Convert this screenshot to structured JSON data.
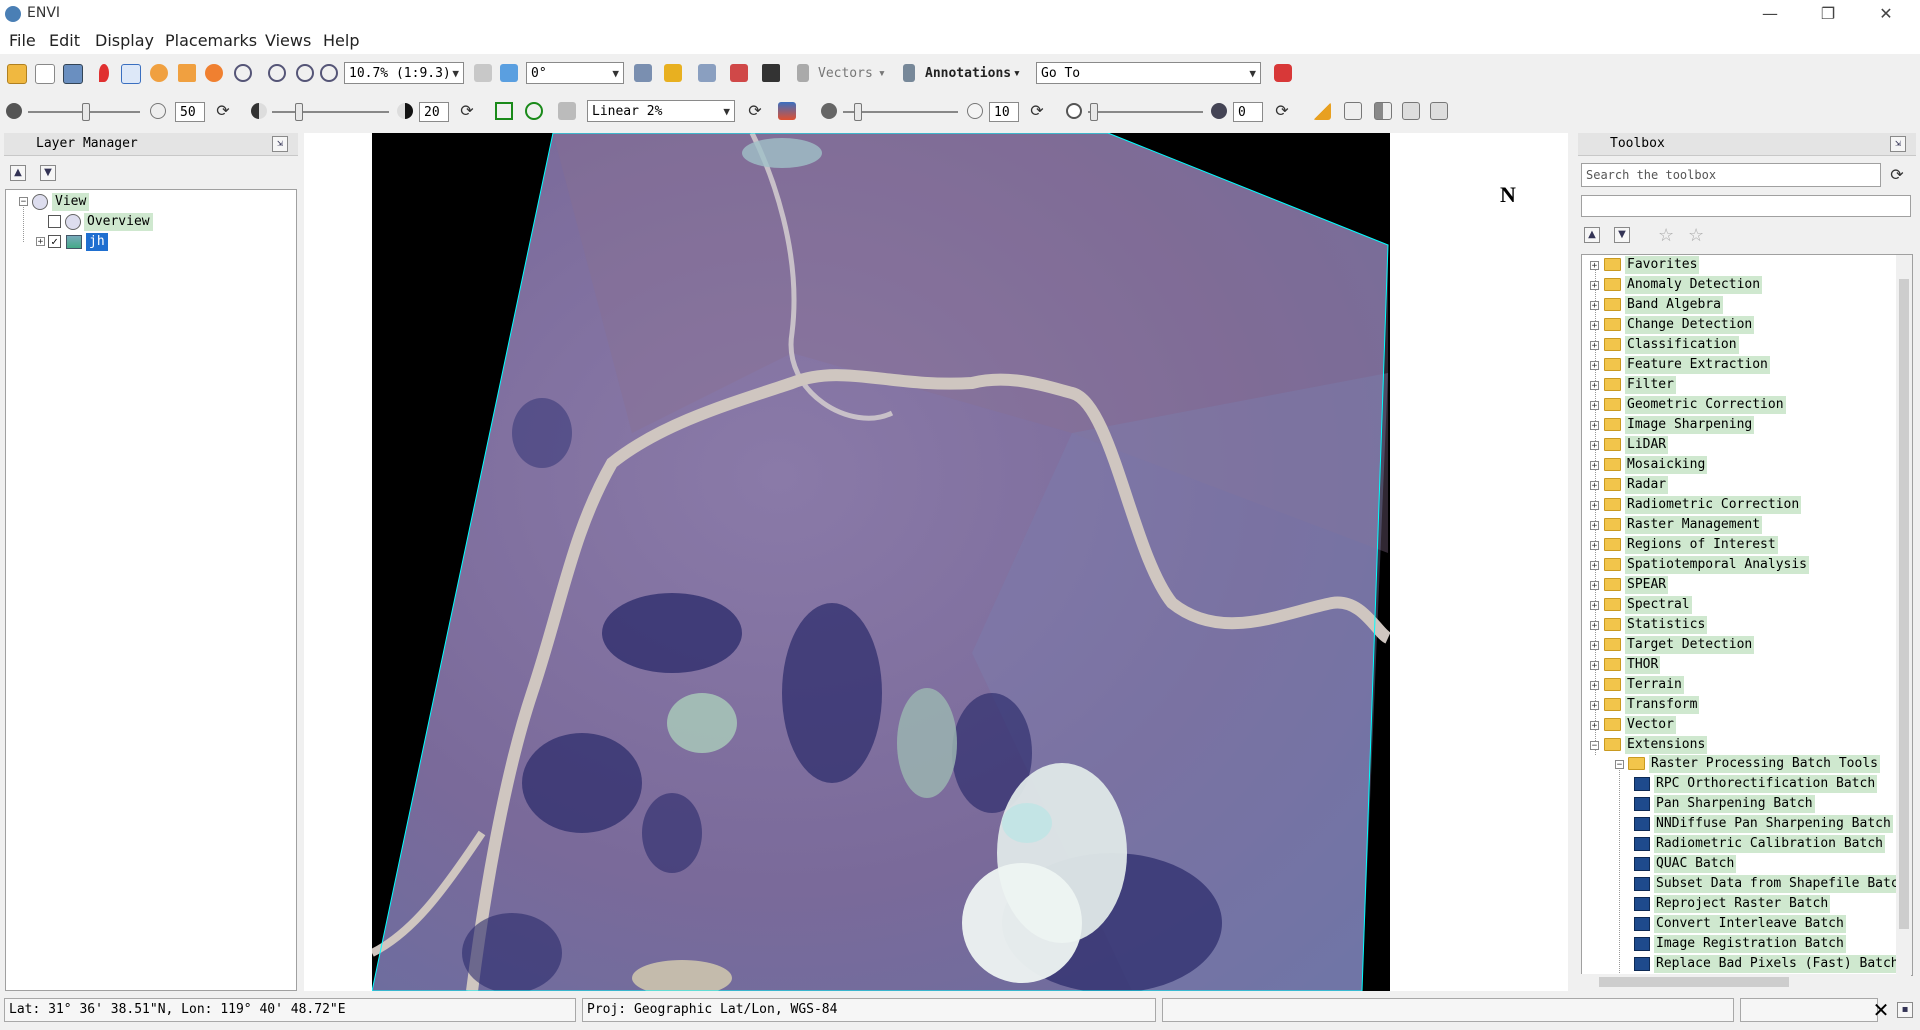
{
  "window": {
    "title": "ENVI",
    "minimize": "—",
    "maximize": "❐",
    "close": "✕"
  },
  "menu": [
    "File",
    "Edit",
    "Display",
    "Placemarks",
    "Views",
    "Help"
  ],
  "toolbar1": {
    "zoom_value": "10.7% (1:9.3)",
    "rotation_value": "0°",
    "vectors_label": "Vectors",
    "annotations_label": "Annotations",
    "goto_value": "Go To"
  },
  "toolbar2": {
    "brightness_value": "50",
    "contrast_value": "20",
    "stretch_value": "Linear 2%",
    "sharpen_value": "10",
    "transparency_value": "0"
  },
  "layer_manager": {
    "title": "Layer Manager",
    "nodes": [
      {
        "label": "View"
      },
      {
        "label": "Overview"
      },
      {
        "label": "jh"
      }
    ]
  },
  "north_arrow": "N",
  "toolbox": {
    "title": "Toolbox",
    "search_placeholder": "Search the toolbox",
    "categories": [
      "Favorites",
      "Anomaly Detection",
      "Band Algebra",
      "Change Detection",
      "Classification",
      "Feature Extraction",
      "Filter",
      "Geometric Correction",
      "Image Sharpening",
      "LiDAR",
      "Mosaicking",
      "Radar",
      "Radiometric Correction",
      "Raster Management",
      "Regions of Interest",
      "Spatiotemporal Analysis",
      "SPEAR",
      "Spectral",
      "Statistics",
      "Target Detection",
      "THOR",
      "Terrain",
      "Transform",
      "Vector",
      "Extensions"
    ],
    "subfolder": "Raster Processing Batch Tools",
    "tools": [
      "RPC Orthorectification Batch",
      "Pan Sharpening Batch",
      "NNDiffuse Pan Sharpening Batch",
      "Radiometric Calibration Batch",
      "QUAC Batch",
      "Subset Data from Shapefile Batch",
      "Reproject Raster Batch",
      "Convert Interleave Batch",
      "Image Registration Batch",
      "Replace Bad Pixels (Fast) Batch"
    ]
  },
  "status": {
    "latlon": "Lat: 31° 36' 38.51\"N, Lon: 119° 40' 48.72\"E",
    "projection": "Proj: Geographic Lat/Lon, WGS-84"
  },
  "colors": {
    "selection": "#1f6fd0",
    "label_highlight": "#cfe8cf",
    "image_border": "#00ffff"
  }
}
